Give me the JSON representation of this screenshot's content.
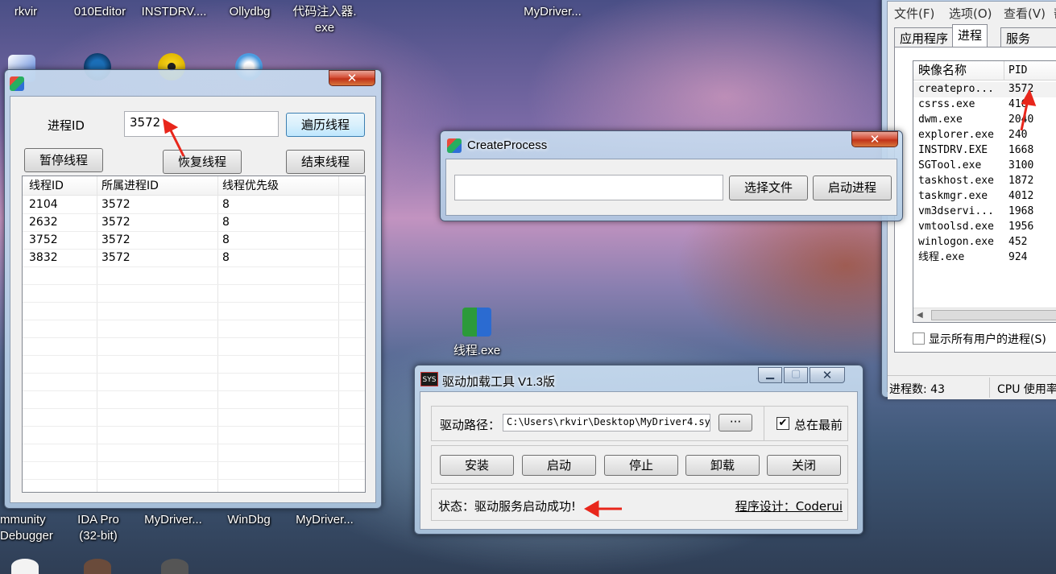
{
  "desktop": {
    "icons_top": [
      "rkvir",
      "010Editor",
      "INSTDRV....",
      "Ollydbg",
      "代码注入器.\nexe",
      "MyDriver..."
    ],
    "icons_bottom": [
      "mmunity\nDebugger",
      "IDA Pro\n(32-bit)",
      "MyDriver...",
      "WinDbg",
      "MyDriver..."
    ],
    "mfc_icon_label": "线程.exe"
  },
  "thread_window": {
    "pid_label": "进程ID",
    "pid_value": "3572",
    "enum_button": "遍历线程",
    "suspend_button": "暂停线程",
    "resume_button": "恢复线程",
    "terminate_button": "结束线程",
    "columns": [
      "线程ID",
      "所属进程ID",
      "线程优先级"
    ],
    "rows": [
      [
        "2104",
        "3572",
        "8"
      ],
      [
        "2632",
        "3572",
        "8"
      ],
      [
        "3752",
        "3572",
        "8"
      ],
      [
        "3832",
        "3572",
        "8"
      ]
    ]
  },
  "create_process": {
    "title": "CreateProcess",
    "path_value": "",
    "select_file_button": "选择文件",
    "start_button": "启动进程"
  },
  "driver_tool": {
    "title": "驱动加载工具 V1.3版",
    "sys_badge": "SYS",
    "path_label": "驱动路径：",
    "path_value": "C:\\Users\\rkvir\\Desktop\\MyDriver4.sy",
    "browse_button": "···",
    "topmost_label": "总在最前",
    "topmost_checked": true,
    "buttons": [
      "安装",
      "启动",
      "停止",
      "卸载",
      "关闭"
    ],
    "status_text": "状态：驱动服务启动成功!",
    "credit": "程序设计：Coderui"
  },
  "task_manager": {
    "menu": [
      "文件(F)",
      "选项(O)",
      "查看(V)",
      "帮"
    ],
    "tabs": [
      "应用程序",
      "进程",
      "服务"
    ],
    "active_tab": "进程",
    "columns": [
      "映像名称",
      "PID"
    ],
    "rows": [
      [
        "createpro...",
        "3572"
      ],
      [
        "csrss.exe",
        "416"
      ],
      [
        "dwm.exe",
        "2040"
      ],
      [
        "explorer.exe",
        "240"
      ],
      [
        "INSTDRV.EXE",
        "1668"
      ],
      [
        "SGTool.exe",
        "3100"
      ],
      [
        "taskhost.exe",
        "1872"
      ],
      [
        "taskmgr.exe",
        "4012"
      ],
      [
        "vm3dservi...",
        "1968"
      ],
      [
        "vmtoolsd.exe",
        "1956"
      ],
      [
        "winlogon.exe",
        "452"
      ],
      [
        "线程.exe",
        "924"
      ]
    ],
    "show_all_users": "显示所有用户的进程(S)",
    "process_count": "进程数: 43",
    "cpu_usage": "CPU 使用率"
  },
  "colors": {
    "arrow": "#e8261b",
    "list_header_sel": "#dcebfc"
  }
}
